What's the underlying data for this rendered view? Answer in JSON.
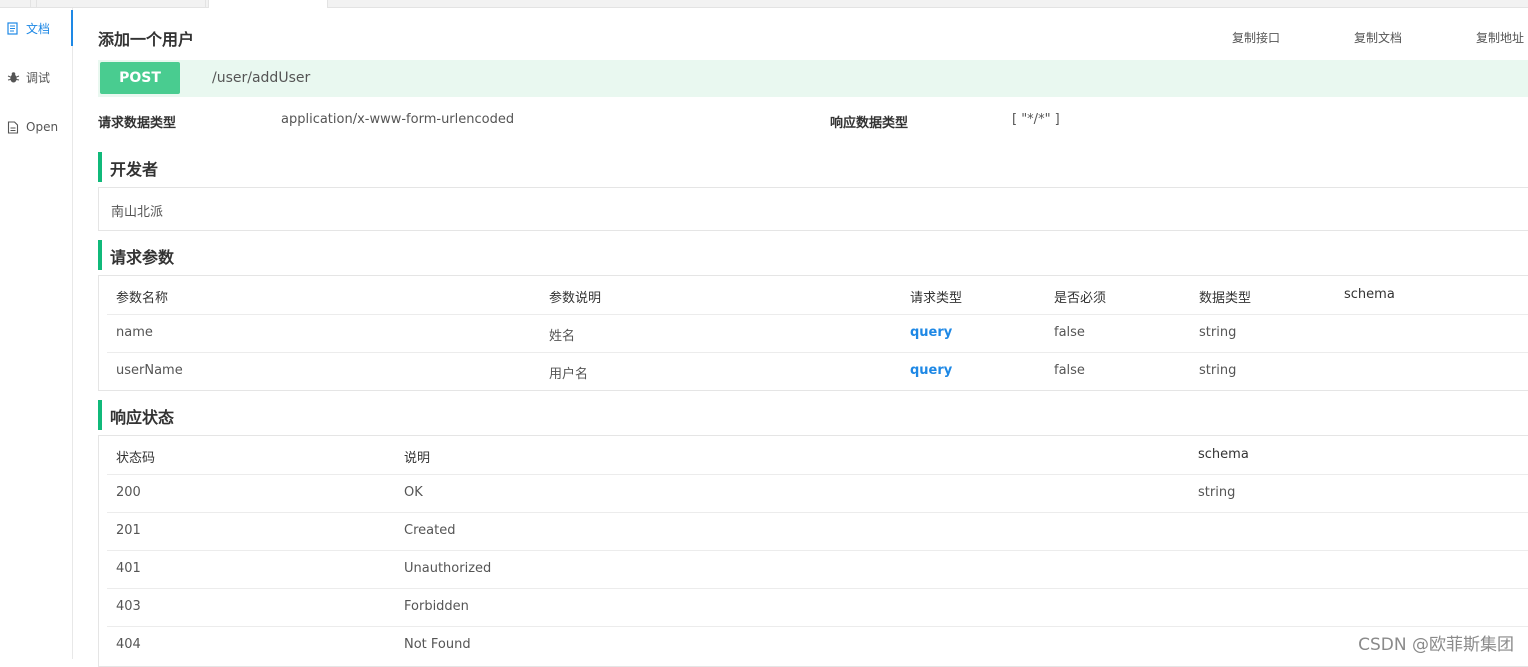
{
  "sidebar": {
    "items": [
      {
        "label": "文档",
        "icon": "document-icon",
        "active": true
      },
      {
        "label": "调试",
        "icon": "bug-icon",
        "active": false
      },
      {
        "label": "Open",
        "icon": "file-icon",
        "active": false
      }
    ]
  },
  "header": {
    "title": "添加一个用户",
    "actions": [
      "复制接口",
      "复制文档",
      "复制地址"
    ]
  },
  "endpoint": {
    "method": "POST",
    "path": "/user/addUser",
    "method_color": "#49cc90",
    "bg_color": "#e9f8f0"
  },
  "meta": {
    "request_type_label": "请求数据类型",
    "request_type_value": "application/x-www-form-urlencoded",
    "response_type_label": "响应数据类型",
    "response_type_value": "[ \"*/*\" ]"
  },
  "developer": {
    "title": "开发者",
    "name": "南山北派"
  },
  "params": {
    "title": "请求参数",
    "headers": [
      "参数名称",
      "参数说明",
      "请求类型",
      "是否必须",
      "数据类型",
      "schema"
    ],
    "rows": [
      [
        "name",
        "姓名",
        "query",
        "false",
        "string",
        ""
      ],
      [
        "userName",
        "用户名",
        "query",
        "false",
        "string",
        ""
      ]
    ]
  },
  "responses": {
    "title": "响应状态",
    "headers": [
      "状态码",
      "说明",
      "schema"
    ],
    "rows": [
      [
        "200",
        "OK",
        "string"
      ],
      [
        "201",
        "Created",
        ""
      ],
      [
        "401",
        "Unauthorized",
        ""
      ],
      [
        "403",
        "Forbidden",
        ""
      ],
      [
        "404",
        "Not Found",
        ""
      ]
    ]
  },
  "watermark": "CSDN @欧菲斯集团",
  "accent_color": "#10b97a",
  "link_color": "#1e88e5"
}
